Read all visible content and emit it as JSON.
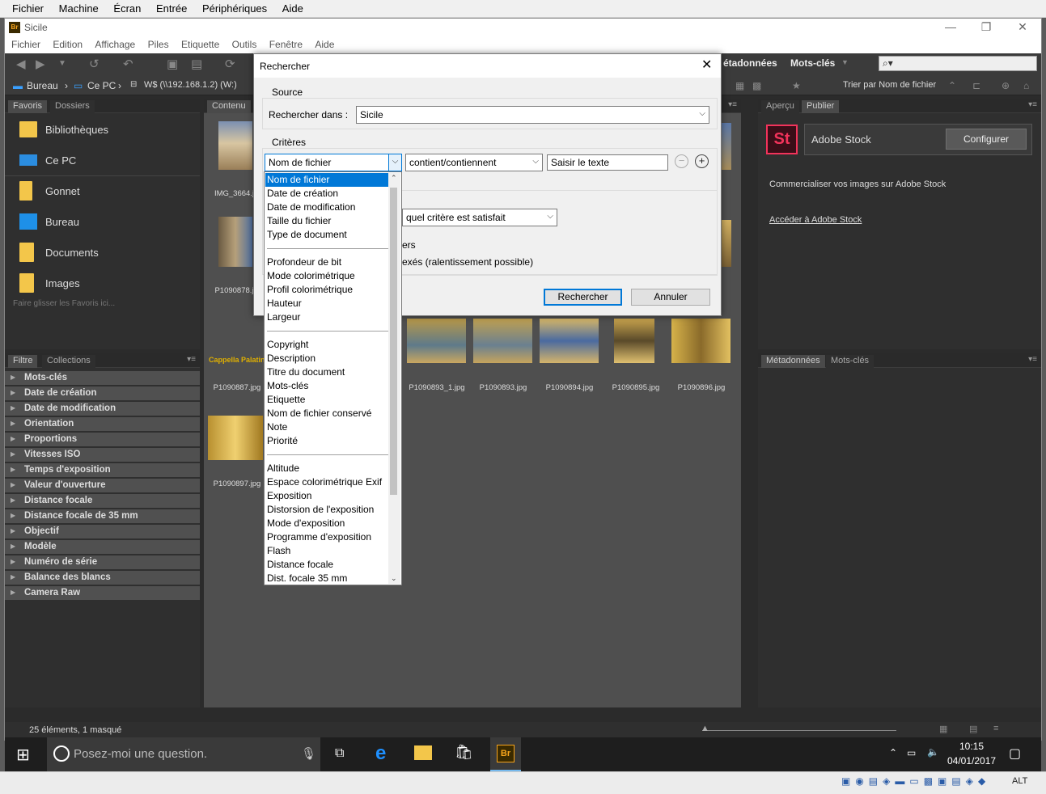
{
  "vm_menu": [
    "Fichier",
    "Machine",
    "Écran",
    "Entrée",
    "Périphériques",
    "Aide"
  ],
  "window": {
    "logo": "Br",
    "title": "Sicile"
  },
  "app_menu": [
    "Fichier",
    "Edition",
    "Affichage",
    "Piles",
    "Etiquette",
    "Outils",
    "Fenêtre",
    "Aide"
  ],
  "toolbar": {
    "metadata_tab": "étadonnées",
    "keywords_tab": "Mots-clés"
  },
  "path": {
    "bureau": "Bureau",
    "ce_pc": "Ce PC",
    "network": "W$ (\\\\192.168.1.2) (W:)",
    "sort": "Trier par Nom de fichier"
  },
  "left_tabs": {
    "favoris": "Favoris",
    "dossiers": "Dossiers"
  },
  "favorites": [
    "Bibliothèques",
    "Ce PC",
    "Gonnet",
    "Bureau",
    "Documents",
    "Images"
  ],
  "fav_hint": "Faire glisser les Favoris ici...",
  "filter_tabs": {
    "filtre": "Filtre",
    "collections": "Collections"
  },
  "filters": [
    "Mots-clés",
    "Date de création",
    "Date de modification",
    "Orientation",
    "Proportions",
    "Vitesses ISO",
    "Temps d'exposition",
    "Valeur d'ouverture",
    "Distance focale",
    "Distance focale de 35 mm",
    "Objectif",
    "Modèle",
    "Numéro de série",
    "Balance des blancs",
    "Camera Raw"
  ],
  "content_tab": "Contenu",
  "thumbs": {
    "row1": [
      "IMG_3664.j"
    ],
    "row2": [
      "P1090878.j"
    ],
    "row3_caption": "Cappella Palatina",
    "row3": [
      "P1090887.jpg",
      "P1090893_1.jpg",
      "P1090893.jpg",
      "P1090894.jpg",
      "P1090895.jpg",
      "P1090896.jpg"
    ],
    "row4": [
      "P1090897.jpg"
    ]
  },
  "right_tabs": {
    "apercu": "Aperçu",
    "publier": "Publier",
    "metadonnees": "Métadonnées",
    "motscles": "Mots-clés"
  },
  "stock": {
    "logo": "St",
    "name": "Adobe Stock",
    "configure": "Configurer",
    "desc": "Commercialiser vos images sur Adobe Stock",
    "link": "Accéder à Adobe Stock"
  },
  "status": "25 éléments, 1 masqué",
  "dialog": {
    "title": "Rechercher",
    "source_label": "Source",
    "search_in_label": "Rechercher dans :",
    "search_in_value": "Sicile",
    "criteria_label": "Critères",
    "field_value": "Nom de fichier",
    "operator_value": "contient/contiennent",
    "text_placeholder": "Saisir le texte",
    "match_value": "quel critère est satisfait",
    "opt1_tail": "ers",
    "opt2_tail": "exés (ralentissement possible)",
    "search_btn": "Rechercher",
    "cancel_btn": "Annuler"
  },
  "dropdown": {
    "group1": [
      "Nom de fichier",
      "Date de création",
      "Date de modification",
      "Taille du fichier",
      "Type de document"
    ],
    "group2": [
      "Profondeur de bit",
      "Mode colorimétrique",
      "Profil colorimétrique",
      "Hauteur",
      "Largeur"
    ],
    "group3": [
      "Copyright",
      "Description",
      "Titre du document",
      "Mots-clés",
      "Etiquette",
      "Nom de fichier conservé",
      "Note",
      "Priorité"
    ],
    "group4": [
      "Altitude",
      "Espace colorimétrique Exif",
      "Exposition",
      "Distorsion de l'exposition",
      "Mode d'exposition",
      "Programme d'exposition",
      "Flash",
      "Distance focale",
      "Dist. focale 35 mm"
    ]
  },
  "taskbar": {
    "search_placeholder": "Posez-moi une question.",
    "br": "Br",
    "time": "10:15",
    "date": "04/01/2017",
    "alt": "ALT"
  }
}
